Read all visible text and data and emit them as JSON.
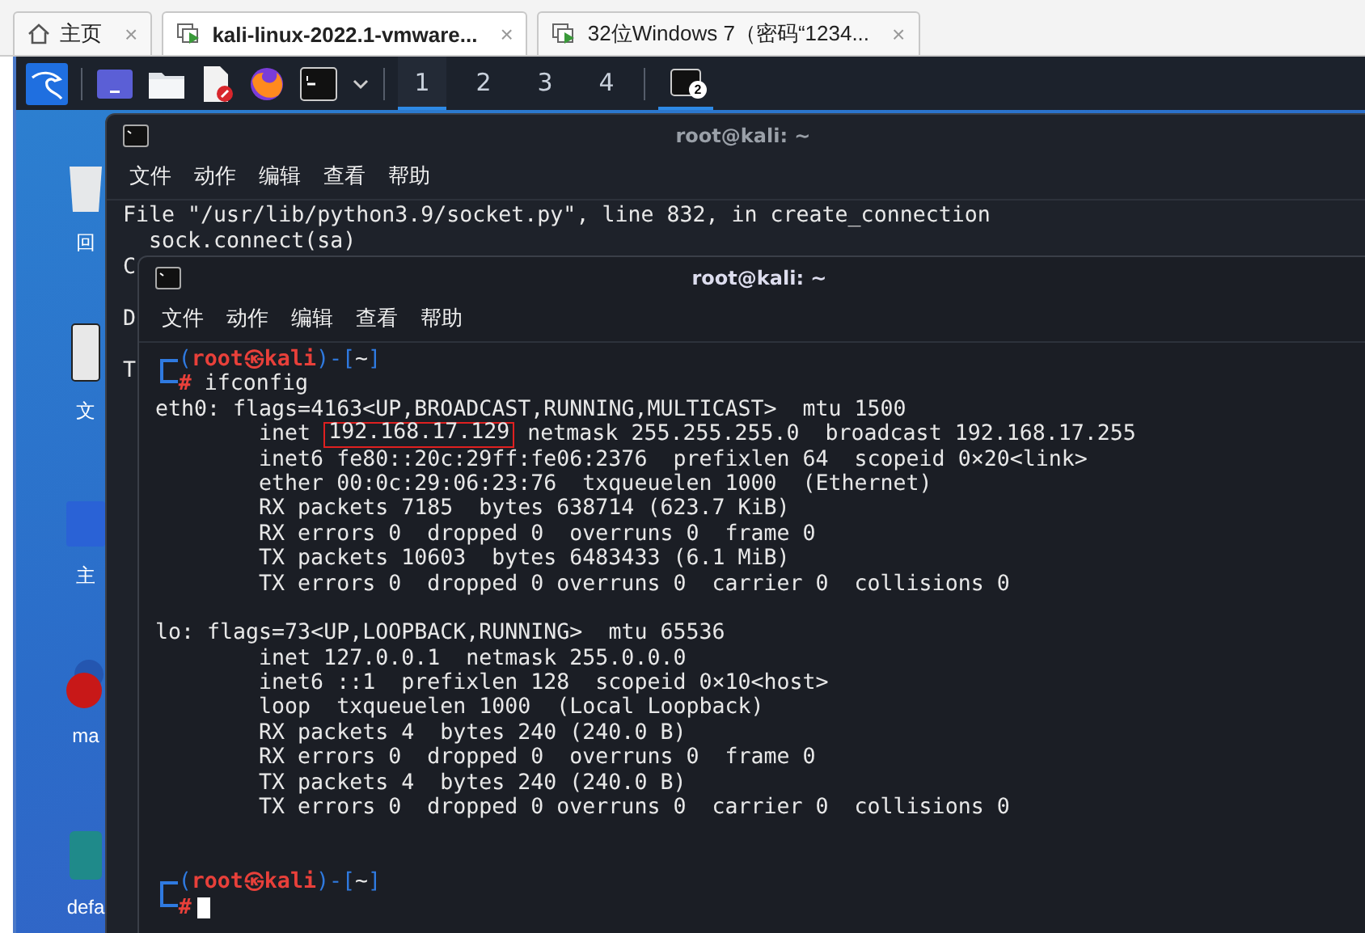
{
  "browser_tabs": [
    {
      "label": "主页",
      "kind": "home",
      "selected": false,
      "close": "×"
    },
    {
      "label": "kali-linux-2022.1-vmware...",
      "kind": "vm",
      "selected": true,
      "close": "×"
    },
    {
      "label": "32位Windows 7（密码“1234...",
      "kind": "vm",
      "selected": false,
      "close": "×"
    }
  ],
  "panel": {
    "launchers": [
      {
        "kind": "kali"
      },
      {
        "kind": "window"
      },
      {
        "kind": "folder"
      },
      {
        "kind": "editor"
      },
      {
        "kind": "browser"
      },
      {
        "kind": "terminal"
      },
      {
        "kind": "caret"
      }
    ],
    "workspaces": [
      {
        "label": "1",
        "selected": true
      },
      {
        "label": "2",
        "selected": false
      },
      {
        "label": "3",
        "selected": false
      },
      {
        "label": "4",
        "selected": false
      }
    ],
    "task": {
      "badge": "2",
      "selected": true
    }
  },
  "desktop_icons": [
    {
      "kind": "trash",
      "label": "回"
    },
    {
      "kind": "drive",
      "label": "文"
    },
    {
      "kind": "home",
      "label": "主"
    },
    {
      "kind": "maltego",
      "label": "ma"
    },
    {
      "kind": "app",
      "label": "defa"
    }
  ],
  "back_terminal": {
    "title": "root@kali: ~",
    "menu": [
      "文件",
      "动作",
      "编辑",
      "查看",
      "帮助"
    ],
    "lines": [
      {
        "kind": "text",
        "text": "File \"/usr/lib/python3.9/socket.py\", line 832, in create_connection"
      },
      {
        "kind": "text",
        "text": "  sock.connect(sa)"
      },
      {
        "kind": "text",
        "text": "C"
      },
      {
        "kind": "blank"
      },
      {
        "kind": "text",
        "text": "D"
      },
      {
        "kind": "blank"
      },
      {
        "kind": "text",
        "text": "T"
      }
    ]
  },
  "front_terminal": {
    "title": "root@kali: ~",
    "menu": [
      "文件",
      "动作",
      "编辑",
      "查看",
      "帮助"
    ],
    "prompts": [
      {
        "open": "(",
        "user_host": "root㉿kali",
        "mid": ")-[",
        "path": "~",
        "close": "]",
        "symbol": "#",
        "command": "ifconfig"
      },
      {
        "open": "(",
        "user_host": "root㉿kali",
        "mid": ")-[",
        "path": "~",
        "close": "]",
        "symbol": "#",
        "cursor": true
      }
    ],
    "output": [
      {
        "kind": "header",
        "text": "eth0: flags=4163<UP,BROADCAST,RUNNING,MULTICAST>  mtu 1500"
      },
      {
        "kind": "detail",
        "text": "inet ",
        "boxed": "192.168.17.129",
        "after": " netmask 255.255.255.0  broadcast 192.168.17.255"
      },
      {
        "kind": "detail",
        "text": "inet6 fe80::20c:29ff:fe06:2376  prefixlen 64  scopeid 0×20<link>"
      },
      {
        "kind": "detail",
        "text": "ether 00:0c:29:06:23:76  txqueuelen 1000  (Ethernet)"
      },
      {
        "kind": "detail",
        "text": "RX packets 7185  bytes 638714 (623.7 KiB)"
      },
      {
        "kind": "detail",
        "text": "RX errors 0  dropped 0  overruns 0  frame 0"
      },
      {
        "kind": "detail",
        "text": "TX packets 10603  bytes 6483433 (6.1 MiB)"
      },
      {
        "kind": "detail",
        "text": "TX errors 0  dropped 0 overruns 0  carrier 0  collisions 0"
      },
      {
        "kind": "blank"
      },
      {
        "kind": "header",
        "text": "lo: flags=73<UP,LOOPBACK,RUNNING>  mtu 65536"
      },
      {
        "kind": "detail",
        "text": "inet 127.0.0.1  netmask 255.0.0.0"
      },
      {
        "kind": "detail",
        "text": "inet6 ::1  prefixlen 128  scopeid 0×10<host>"
      },
      {
        "kind": "detail",
        "text": "loop  txqueuelen 1000  (Local Loopback)"
      },
      {
        "kind": "detail",
        "text": "RX packets 4  bytes 240 (240.0 B)"
      },
      {
        "kind": "detail",
        "text": "RX errors 0  dropped 0  overruns 0  frame 0"
      },
      {
        "kind": "detail",
        "text": "TX packets 4  bytes 240 (240.0 B)"
      },
      {
        "kind": "detail",
        "text": "TX errors 0  dropped 0 overruns 0  carrier 0  collisions 0"
      },
      {
        "kind": "blank"
      },
      {
        "kind": "blank"
      }
    ]
  }
}
